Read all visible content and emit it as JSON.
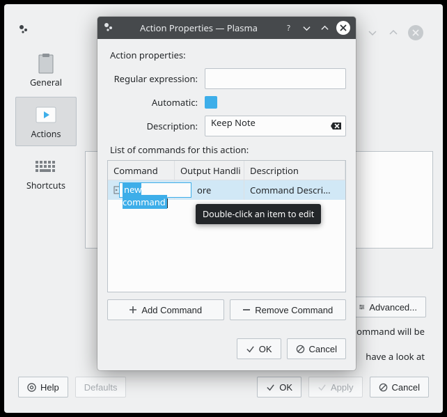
{
  "bg": {
    "sidebar": {
      "items": [
        {
          "label": "General"
        },
        {
          "label": "Actions"
        },
        {
          "label": "Shortcuts"
        }
      ]
    },
    "advanced_label": "Advanced...",
    "hint_line1_tail": "ommand will be",
    "hint_line2_tail": "have a look at",
    "buttons": {
      "help": "Help",
      "defaults": "Defaults",
      "ok": "OK",
      "apply": "Apply",
      "cancel": "Cancel"
    }
  },
  "dialog": {
    "title": "Action Properties — Plasma",
    "heading": "Action properties:",
    "labels": {
      "regex": "Regular expression:",
      "automatic": "Automatic:",
      "description": "Description:"
    },
    "fields": {
      "regex": "",
      "description": "Keep Note"
    },
    "cmd_list_label": "List of commands for this action:",
    "columns": {
      "command": "Command",
      "output": "Output Handling",
      "description": "Description"
    },
    "row": {
      "command_edit_value": "new command",
      "output_truncated": "ore",
      "description_truncated": "Command Descri..."
    },
    "tooltip": "Double-click an item to edit",
    "buttons": {
      "add": "Add Command",
      "remove": "Remove Command",
      "ok": "OK",
      "cancel": "Cancel"
    }
  }
}
